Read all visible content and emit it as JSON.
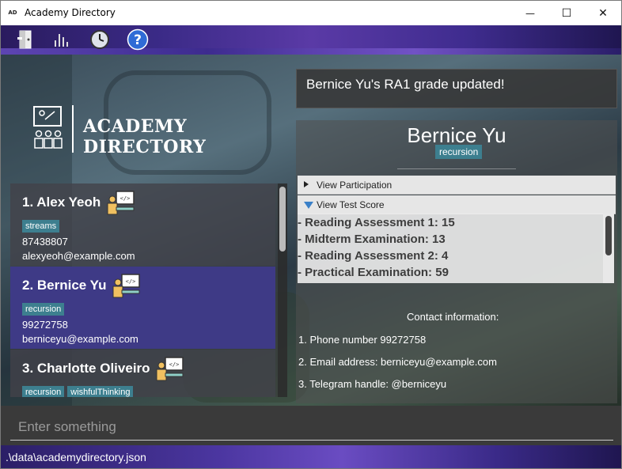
{
  "window": {
    "app_icon_text": "AD",
    "title": "Academy Directory",
    "minimize_glyph": "—",
    "maximize_glyph": "☐",
    "close_glyph": "✕"
  },
  "toolbar": {
    "icons": [
      "exit-icon",
      "stats-icon",
      "history-icon",
      "help-icon"
    ],
    "help_glyph": "?"
  },
  "logo": {
    "text": "ACADEMY DIRECTORY"
  },
  "people": [
    {
      "index_name": "1.  Alex Yeoh",
      "tags": [
        "streams"
      ],
      "phone": "87438807",
      "email": "alexyeoh@example.com"
    },
    {
      "index_name": "2.  Bernice Yu",
      "tags": [
        "recursion"
      ],
      "phone": "99272758",
      "email": "berniceyu@example.com"
    },
    {
      "index_name": "3.  Charlotte Oliveiro",
      "tags": [
        "recursion",
        "wishfulThinking"
      ],
      "phone": "",
      "email": ""
    }
  ],
  "result": {
    "message": "Bernice Yu's RA1 grade updated!"
  },
  "details": {
    "name": "Bernice Yu",
    "tag": "recursion",
    "participation_label": "View Participation",
    "test_score_label": "View Test Score",
    "scores": [
      "- Reading Assessment 1: 15",
      "- Midterm Examination: 13",
      "- Reading Assessment 2: 4",
      "- Practical Examination: 59"
    ],
    "contact_title": "Contact information:",
    "contact_lines": [
      "1. Phone number 99272758",
      "2. Email address: berniceyu@example.com",
      "3. Telegram handle: @berniceyu"
    ]
  },
  "command": {
    "placeholder": "Enter something"
  },
  "status": {
    "path": ".\\data\\academydirectory.json"
  },
  "colors": {
    "tag": "#3d7f8f",
    "selected_card": "#3e3a86",
    "toolbar": "#3a2a86"
  }
}
